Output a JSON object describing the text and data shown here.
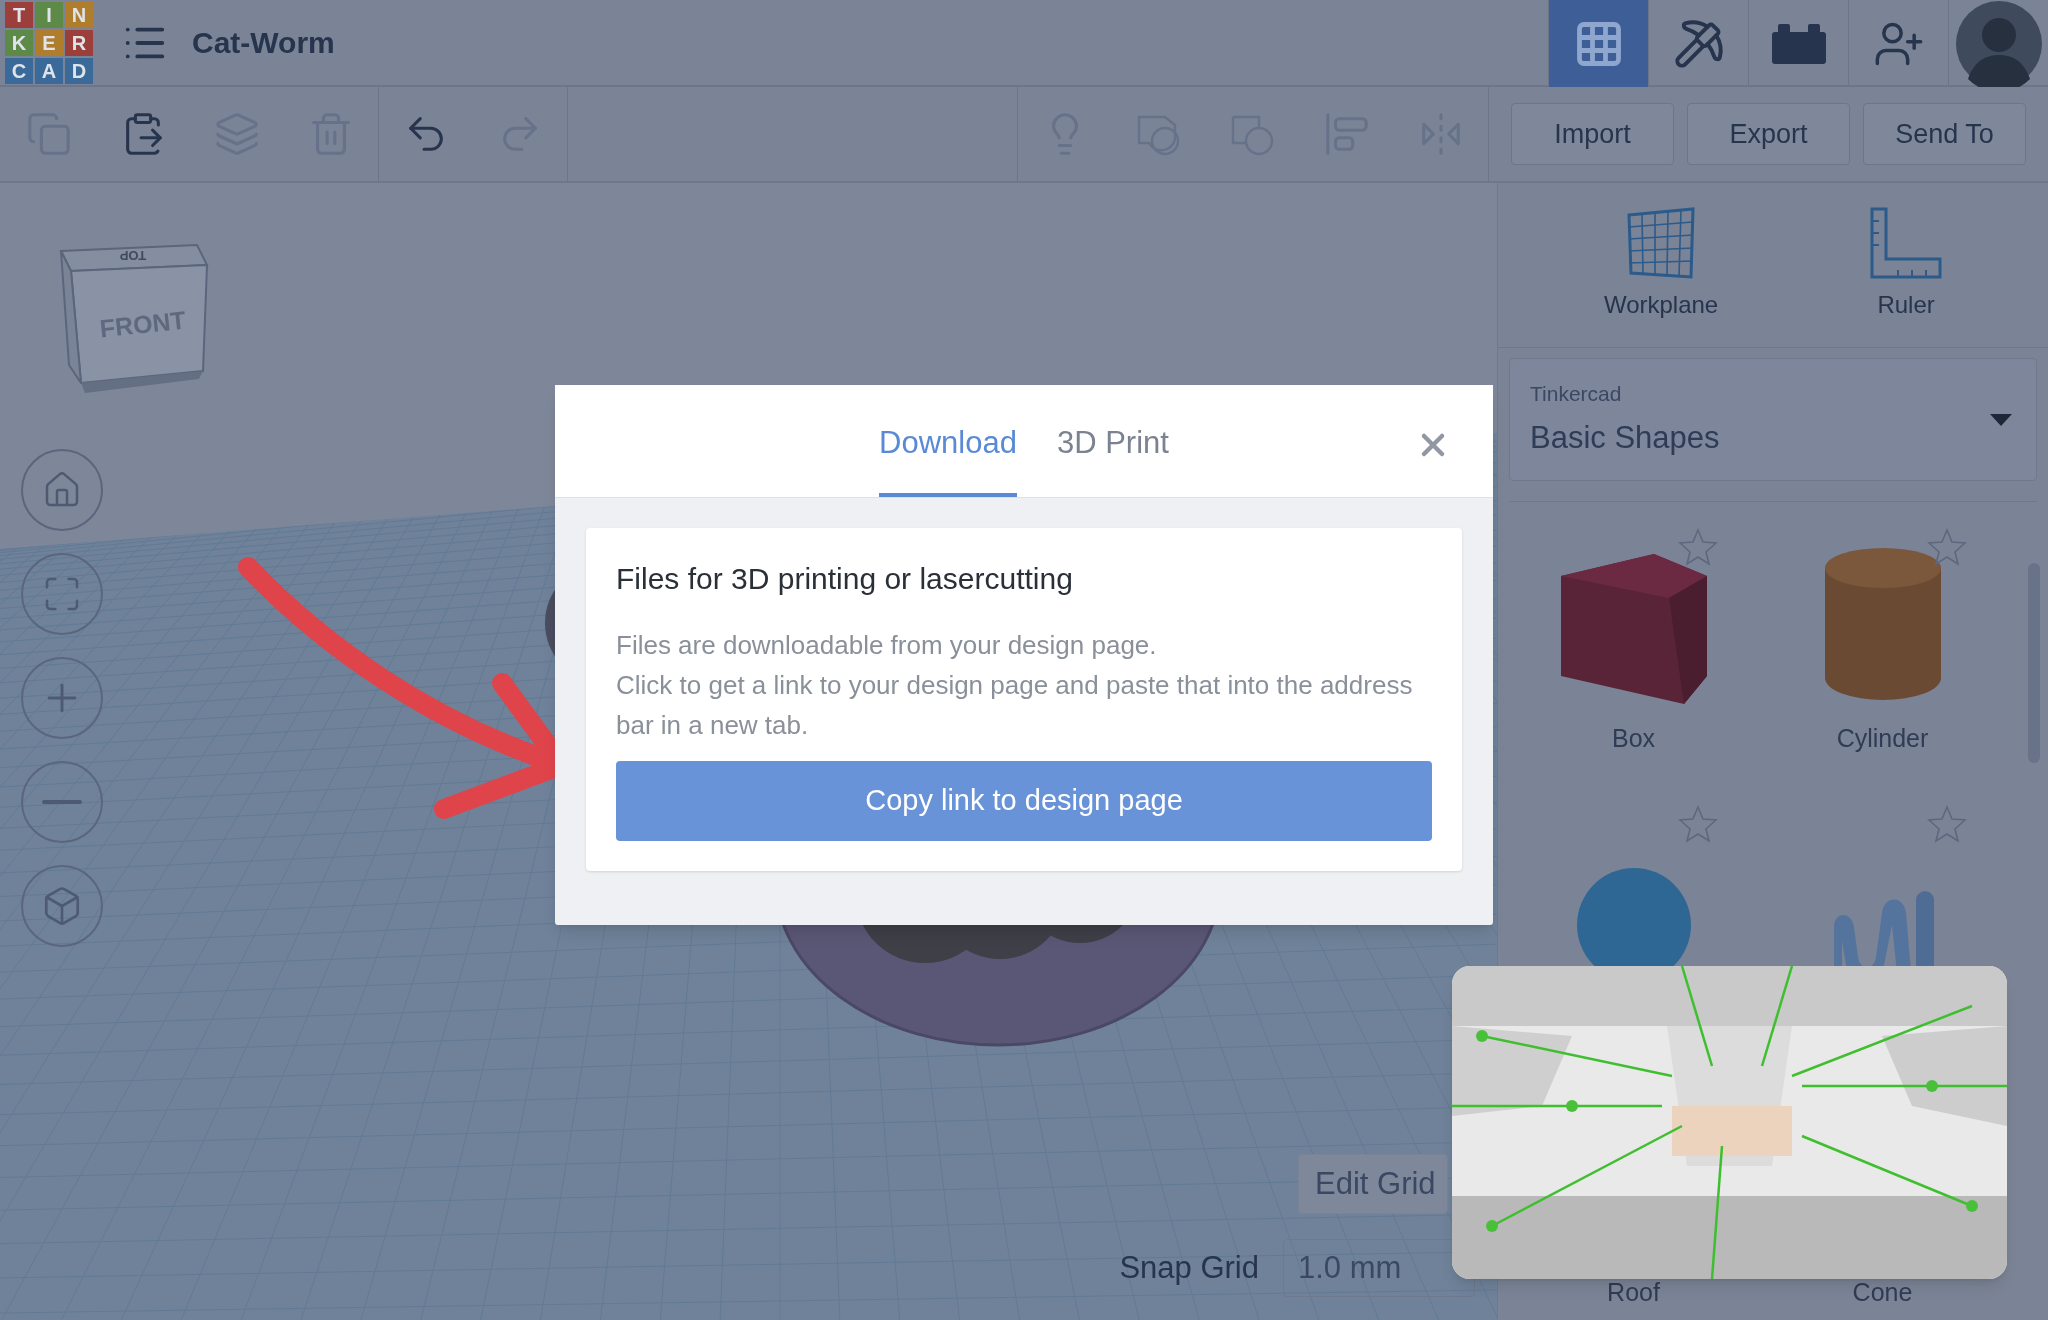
{
  "header": {
    "logo": [
      "T",
      "I",
      "N",
      "K",
      "E",
      "R",
      "C",
      "A",
      "D"
    ],
    "title": "Cat-Worm",
    "nav": [
      {
        "kind": "grid",
        "selected": true
      },
      {
        "kind": "pickaxe",
        "selected": false
      },
      {
        "kind": "bricks",
        "selected": false
      },
      {
        "kind": "add-user",
        "selected": false
      },
      {
        "kind": "avatar",
        "selected": false
      }
    ]
  },
  "toolbar": {
    "edit_tools": [
      {
        "kind": "copy",
        "disabled": true
      },
      {
        "kind": "paste",
        "disabled": false
      },
      {
        "kind": "duplicate",
        "disabled": true
      },
      {
        "kind": "delete",
        "disabled": true
      }
    ],
    "history": [
      {
        "kind": "undo",
        "disabled": false
      },
      {
        "kind": "redo",
        "disabled": true
      }
    ],
    "shape_tools": [
      {
        "kind": "lightbulb",
        "disabled": true
      },
      {
        "kind": "group",
        "disabled": true
      },
      {
        "kind": "ungroup",
        "disabled": true
      },
      {
        "kind": "align",
        "disabled": true
      },
      {
        "kind": "mirror",
        "disabled": true
      }
    ],
    "actions": [
      "Import",
      "Export",
      "Send To"
    ]
  },
  "viewport": {
    "view_cube": {
      "front": "FRONT",
      "top": "TOP"
    },
    "nav_buttons": [
      {
        "kind": "home"
      },
      {
        "kind": "fit"
      },
      {
        "kind": "zoom-in"
      },
      {
        "kind": "zoom-out"
      },
      {
        "kind": "perspective"
      }
    ],
    "edit_grid": "Edit Grid",
    "snap_grid": {
      "label": "Snap Grid",
      "value": "1.0 mm"
    }
  },
  "panel": {
    "tools": [
      {
        "kind": "workplane",
        "label": "Workplane"
      },
      {
        "kind": "ruler",
        "label": "Ruler"
      }
    ],
    "library": {
      "label": "Tinkercad",
      "value": "Basic Shapes"
    },
    "shapes": [
      {
        "label": "Box",
        "kind": "box",
        "favorite": false
      },
      {
        "label": "Cylinder",
        "kind": "cylinder",
        "favorite": false
      },
      {
        "kind": "sphere",
        "favorite": false
      },
      {
        "kind": "scribble",
        "favorite": false
      },
      {
        "label": "Roof"
      },
      {
        "label": "Cone"
      }
    ]
  },
  "dialog": {
    "tabs": [
      {
        "label": "Download",
        "selected": true
      },
      {
        "label": "3D Print",
        "selected": false
      }
    ],
    "card": {
      "title": "Files for 3D printing or lasercutting",
      "lines": [
        "Files are downloadable from your design page.",
        "Click to get a link to your design page and paste that into the address bar in a new tab."
      ],
      "button": "Copy link to design page"
    }
  }
}
